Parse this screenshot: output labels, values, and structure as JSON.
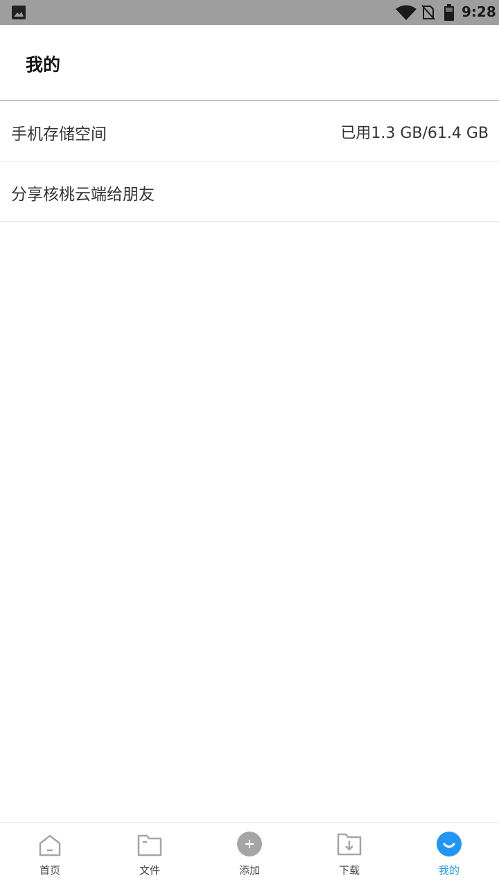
{
  "status_bar": {
    "time": "9:28"
  },
  "header": {
    "title": "我的"
  },
  "list": {
    "storage": {
      "label": "手机存储空间",
      "value": "已用1.3 GB/61.4 GB"
    },
    "share": {
      "label": "分享核桃云端给朋友"
    }
  },
  "bottom_nav": {
    "items": [
      {
        "label": "首页",
        "icon": "home-icon"
      },
      {
        "label": "文件",
        "icon": "folder-icon"
      },
      {
        "label": "添加",
        "icon": "add-icon"
      },
      {
        "label": "下载",
        "icon": "download-icon"
      },
      {
        "label": "我的",
        "icon": "profile-icon"
      }
    ],
    "active_index": 4
  },
  "colors": {
    "accent": "#2196f3",
    "status_bar": "#9e9e9e",
    "icon_gray": "#a5a5a5"
  }
}
